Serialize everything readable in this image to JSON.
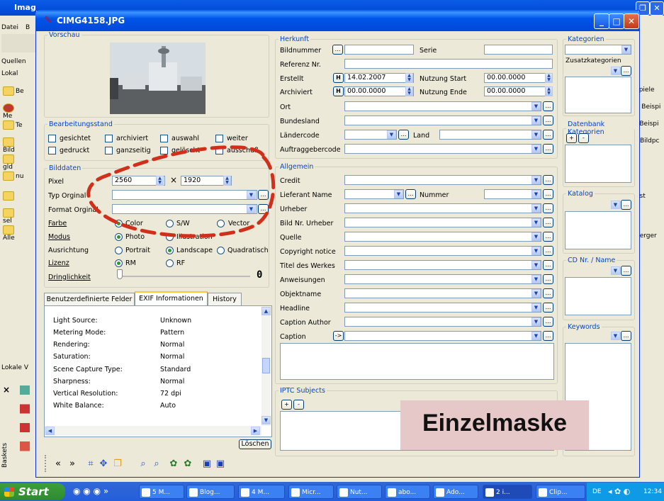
{
  "background_app": {
    "title": "Imag",
    "menu": [
      "Datei",
      "B"
    ],
    "left_labels": [
      "Quellen",
      "Lokal",
      "Lokale V",
      "Baskets"
    ],
    "folders": [
      "Be",
      "Me",
      "Te",
      "Bild",
      "gld",
      "nu",
      "",
      "sel",
      "Alle"
    ],
    "right_labels": [
      "spiele",
      "P Beispi",
      "l Beispi",
      "/-Bildpc",
      "ost",
      "berger"
    ]
  },
  "window": {
    "title": "CIMG4158.JPG"
  },
  "vorschau": {
    "legend": "Vorschau"
  },
  "bearbeitungsstand": {
    "legend": "Bearbeitungsstand",
    "checkboxes": [
      "gesichtet",
      "archiviert",
      "auswahl",
      "weiter",
      "gedruckt",
      "ganzseitig",
      "gelöscht",
      "ausschuß"
    ]
  },
  "bilddaten": {
    "legend": "Bilddaten",
    "pixel_label": "Pixel",
    "pixel_w": "2560",
    "times": "×",
    "pixel_h": "1920",
    "typ_label": "Typ Orginal",
    "format_label": "Format Orginal",
    "farbe_label": "Farbe",
    "farbe_options": [
      "Color",
      "S/W",
      "Vector"
    ],
    "modus_label": "Modus",
    "modus_options": [
      "Photo",
      "Illustration"
    ],
    "ausrichtung_label": "Ausrichtung",
    "ausrichtung_options": [
      "Portrait",
      "Landscape",
      "Quadratisch"
    ],
    "lizenz_label": "Lizenz",
    "lizenz_options": [
      "RM",
      "RF"
    ],
    "dringlichkeit_label": "Dringlichkeit",
    "dringlichkeit_value": "0"
  },
  "tabs": [
    "Benutzerdefinierte Felder",
    "EXIF Informationen",
    "History"
  ],
  "exif": [
    {
      "key": "Light Source:",
      "value": "Unknown"
    },
    {
      "key": "Metering Mode:",
      "value": "Pattern"
    },
    {
      "key": "Rendering:",
      "value": "Normal"
    },
    {
      "key": "Saturation:",
      "value": "Normal"
    },
    {
      "key": "Scene Capture Type:",
      "value": "Standard"
    },
    {
      "key": "Sharpness:",
      "value": "Normal"
    },
    {
      "key": "Vertical Resolution:",
      "value": "72 dpi"
    },
    {
      "key": "White Balance:",
      "value": "Auto"
    }
  ],
  "loeschen": "Löschen",
  "herkunft": {
    "legend": "Herkunft",
    "bildnummer": "Bildnummer",
    "serie": "Serie",
    "referenz": "Referenz Nr.",
    "erstellt": "Erstellt",
    "erstellt_value": "14.02.2007",
    "nutzung_start": "Nutzung Start",
    "nutzung_start_value": "00.00.0000",
    "archiviert": "Archiviert",
    "archiviert_value": "00.00.0000",
    "nutzung_ende": "Nutzung Ende",
    "nutzung_ende_value": "00.00.0000",
    "h": "H",
    "ort": "Ort",
    "bundesland": "Bundesland",
    "laendercode": "Ländercode",
    "land": "Land",
    "auftraggeber": "Auftraggebercode"
  },
  "allgemein": {
    "legend": "Allgemein",
    "credit": "Credit",
    "lieferant": "Lieferant Name",
    "nummer": "Nummer",
    "fields": [
      "Urheber",
      "Bild Nr. Urheber",
      "Quelle",
      "Copyright notice",
      "Titel des Werkes",
      "Anweisungen",
      "Objektname",
      "Headline",
      "Caption Author"
    ],
    "caption": "Caption",
    "caption_btn": "->"
  },
  "iptc": {
    "legend": "IPTC Subjects"
  },
  "right_panel": {
    "kategorien": "Kategorien",
    "zusatzkategorien": "Zusatzkategorien",
    "datenbank": "Datenbank Kategorien",
    "katalog": "Katalog",
    "cd": "CD Nr. / Name",
    "keywords": "Keywords"
  },
  "overlay_label": "Einzelmaske",
  "taskbar": {
    "start": "Start",
    "items": [
      "5 M...",
      "Blog...",
      "4 M...",
      "Micr...",
      "Nut...",
      "abo...",
      "Ado...",
      "2 i...",
      "Clip..."
    ],
    "lang": "DE",
    "clock": "12:34"
  },
  "colors": {
    "xp_blue": "#0054e3",
    "dialog_bg": "#ece9d8",
    "dash_red": "#d0301b",
    "overlay_bg": "#e6c8c8"
  }
}
